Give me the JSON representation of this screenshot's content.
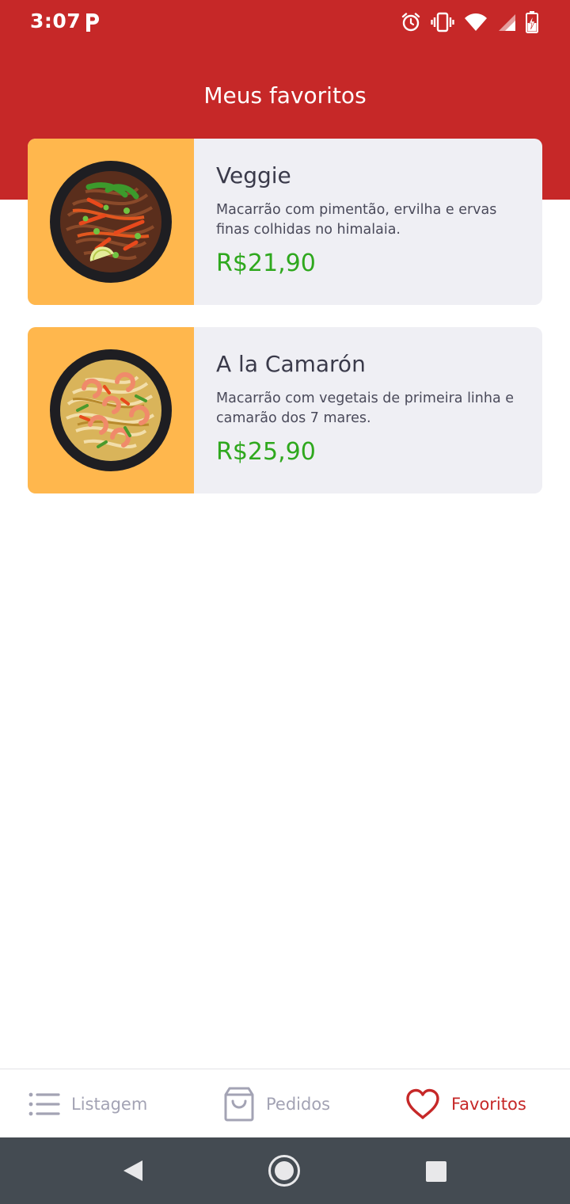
{
  "status_bar": {
    "time": "3:07",
    "icons": [
      "parking-icon",
      "alarm-icon",
      "vibrate-icon",
      "wifi-icon",
      "signal-icon",
      "battery-charging-icon"
    ]
  },
  "header": {
    "title": "Meus favoritos",
    "color": "#c62828"
  },
  "favorites": [
    {
      "name": "Veggie",
      "description": "Macarrão com pimentão, ervilha e ervas finas colhidas no himalaia.",
      "price": "R$21,90",
      "image": "veggie-noodle-bowl"
    },
    {
      "name": "A la Camarón",
      "description": "Macarrão com vegetais de primeira linha e camarão dos 7 mares.",
      "price": "R$25,90",
      "image": "shrimp-noodle-bowl"
    }
  ],
  "bottom_nav": {
    "items": [
      {
        "label": "Listagem",
        "icon": "list-icon",
        "active": false
      },
      {
        "label": "Pedidos",
        "icon": "shopping-bag-icon",
        "active": false
      },
      {
        "label": "Favoritos",
        "icon": "heart-icon",
        "active": true
      }
    ],
    "active_color": "#c62828",
    "inactive_color": "#a3a3b4"
  },
  "colors": {
    "card_background": "#efeff4",
    "thumb_background": "#ffb74d",
    "price": "#2fa81e"
  },
  "system_nav": {
    "buttons": [
      "back-icon",
      "home-icon",
      "recents-icon"
    ]
  }
}
